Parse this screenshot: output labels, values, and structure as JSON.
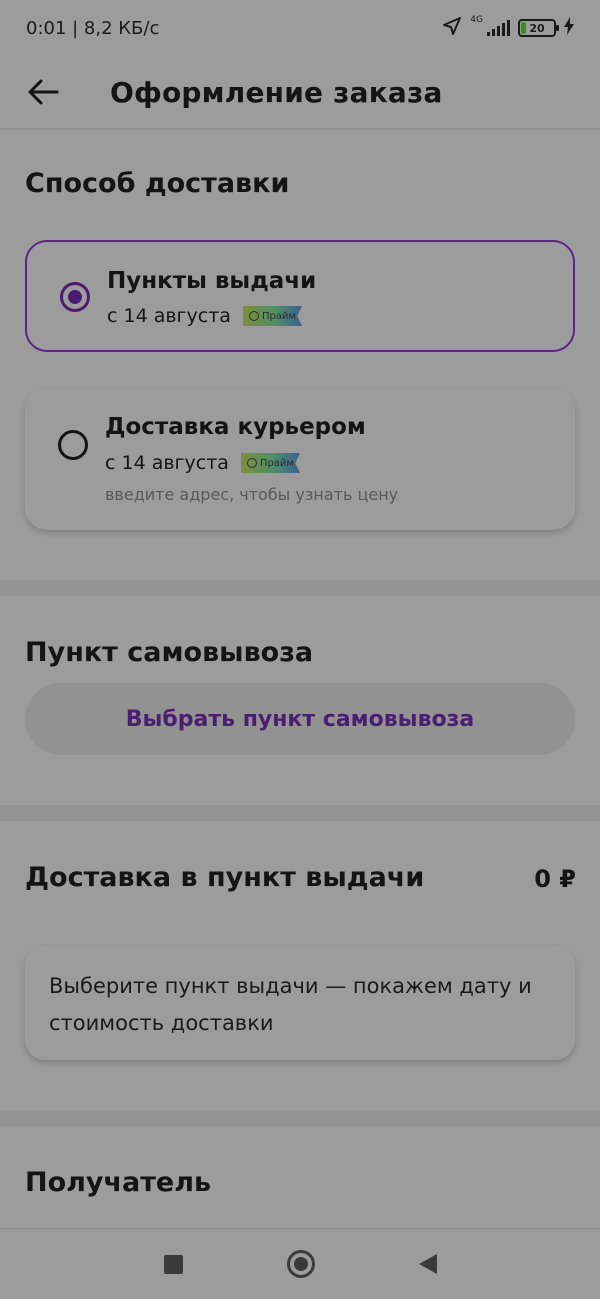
{
  "statusbar": {
    "time_speed": "0:01 | 8,2 КБ/с",
    "network": "4G",
    "battery": "20"
  },
  "header": {
    "title": "Оформление заказа"
  },
  "delivery_method": {
    "title": "Способ доставки",
    "options": [
      {
        "label": "Пункты выдачи",
        "date": "с 14 августа",
        "badge": "Прайм",
        "selected": true
      },
      {
        "label": "Доставка курьером",
        "date": "с 14 августа",
        "badge": "Прайм",
        "note": "введите адрес, чтобы узнать цену",
        "selected": false
      }
    ]
  },
  "pickup": {
    "title": "Пункт самовывоза",
    "button_label": "Выбрать пункт самовывоза"
  },
  "delivery_cost": {
    "title": "Доставка в пункт выдачи",
    "price": "0 ₽",
    "info": "Выберите пункт выдачи — покажем дату и стоимость доставки"
  },
  "recipient": {
    "title": "Получатель"
  },
  "colors": {
    "accent": "#5b2382",
    "overlay_background": "#9c9c9c"
  }
}
